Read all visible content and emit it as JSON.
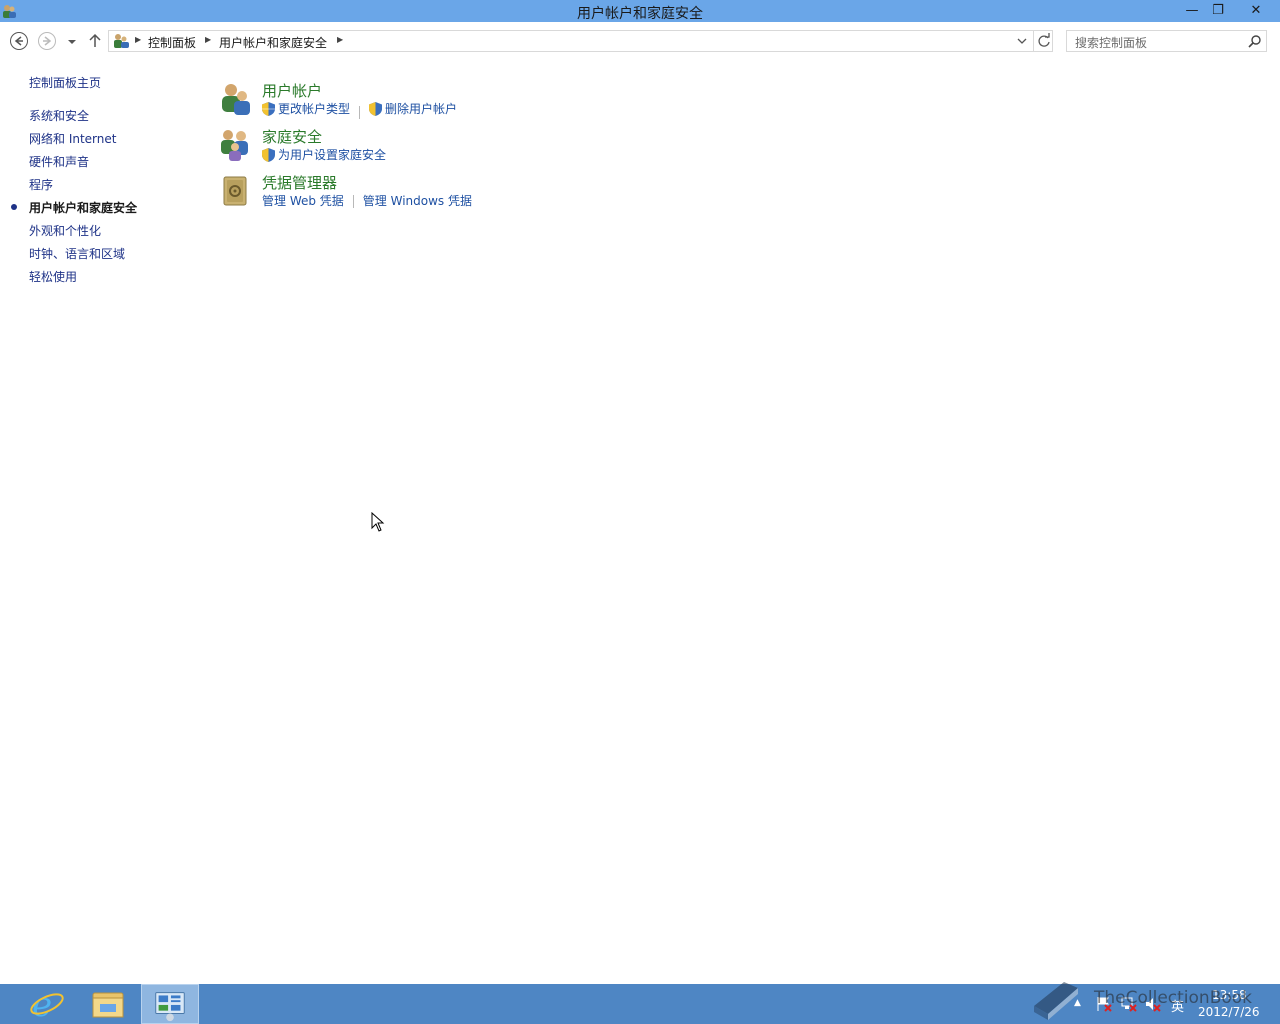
{
  "window": {
    "title": "用户帐户和家庭安全",
    "minimize_glyph": "—",
    "maximize_glyph": "❐",
    "close_glyph": "✕"
  },
  "address_bar": {
    "icon": "control-panel-icon",
    "breadcrumbs": [
      "控制面板",
      "用户帐户和家庭安全"
    ]
  },
  "search": {
    "placeholder": "搜索控制面板"
  },
  "sidebar": {
    "home": "控制面板主页",
    "items": [
      {
        "label": "系统和安全",
        "active": false
      },
      {
        "label": "网络和 Internet",
        "active": false
      },
      {
        "label": "硬件和声音",
        "active": false
      },
      {
        "label": "程序",
        "active": false
      },
      {
        "label": "用户帐户和家庭安全",
        "active": true
      },
      {
        "label": "外观和个性化",
        "active": false
      },
      {
        "label": "时钟、语言和区域",
        "active": false
      },
      {
        "label": "轻松使用",
        "active": false
      }
    ]
  },
  "categories": [
    {
      "title": "用户帐户",
      "icon": "user-accounts-icon",
      "links": [
        {
          "label": "更改帐户类型",
          "shield": true
        },
        {
          "label": "删除用户帐户",
          "shield": true
        }
      ]
    },
    {
      "title": "家庭安全",
      "icon": "family-safety-icon",
      "links": [
        {
          "label": "为用户设置家庭安全",
          "shield": true
        }
      ]
    },
    {
      "title": "凭据管理器",
      "icon": "credential-manager-icon",
      "links": [
        {
          "label": "管理 Web 凭据",
          "shield": false
        },
        {
          "label": "管理 Windows 凭据",
          "shield": false
        }
      ]
    }
  ],
  "taskbar": {
    "pinned": [
      "internet-explorer-icon",
      "file-explorer-icon",
      "control-panel-icon"
    ],
    "active": "control-panel-icon",
    "tray": {
      "ime": "英",
      "time": "13:58",
      "date": "2012/7/26"
    }
  },
  "watermark": "TheCollectionBook",
  "colors": {
    "titlebar": "#6aa6e8",
    "taskbar": "#4e86c4",
    "category_title": "#2a7a2a",
    "link": "#1e50a2",
    "nav_link": "#1e3287"
  }
}
